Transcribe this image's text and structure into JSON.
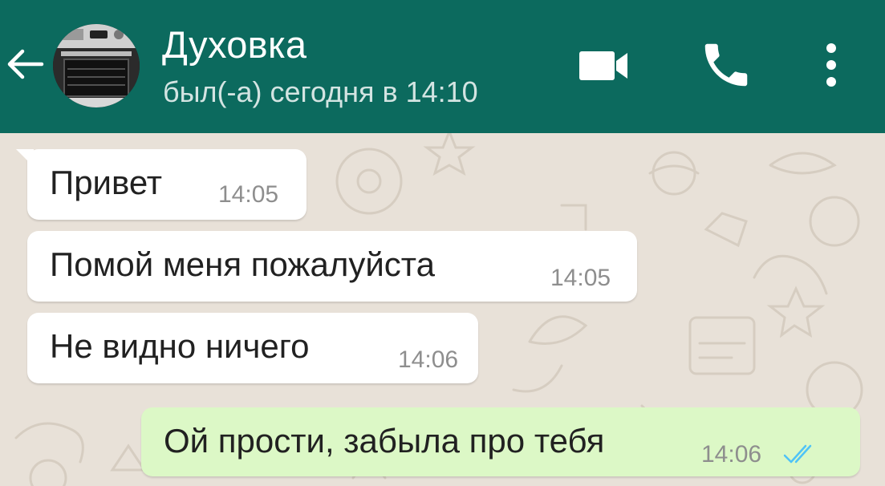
{
  "header": {
    "contact_name": "Духовка",
    "status": "был(-а) сегодня в 14:10",
    "colors": {
      "bar": "#0c6a5e",
      "text": "#ffffff"
    },
    "icons": [
      "back-arrow-icon",
      "video-call-icon",
      "voice-call-icon",
      "more-options-icon"
    ]
  },
  "messages": [
    {
      "direction": "incoming",
      "text": "Привет",
      "time": "14:05"
    },
    {
      "direction": "incoming",
      "text": "Помой меня пожалуйста",
      "time": "14:05"
    },
    {
      "direction": "incoming",
      "text": "Не видно ничего",
      "time": "14:06"
    },
    {
      "direction": "outgoing",
      "text": "Ой прости, забыла про тебя",
      "time": "14:06",
      "status": "read"
    }
  ],
  "colors": {
    "incoming_bubble": "#ffffff",
    "outgoing_bubble": "#dcf8c6",
    "read_check": "#4fc3f7",
    "chat_background": "#e8e1d8"
  }
}
